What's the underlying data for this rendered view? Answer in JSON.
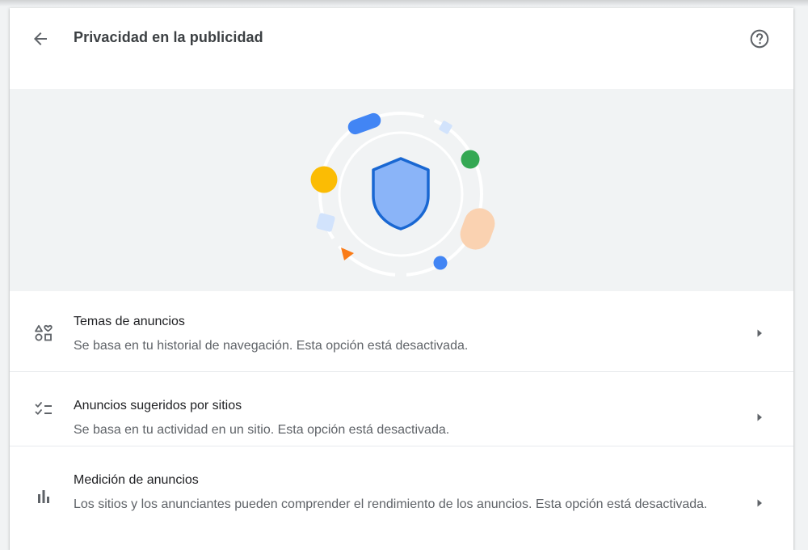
{
  "header": {
    "title": "Privacidad en la publicidad",
    "back_icon": "arrow-back-icon",
    "help_icon": "help-circle-icon"
  },
  "illustration": {
    "icon": "shield-icon",
    "colors": {
      "background": "#f1f3f4",
      "shield_fill": "#8ab4f8",
      "shield_stroke": "#1967d2",
      "blue": "#4285f4",
      "green": "#34a853",
      "yellow": "#fbbc04",
      "orange": "#fa7b17",
      "peach": "#fad2b1",
      "light_blue": "#d2e3fc"
    }
  },
  "settings": [
    {
      "icon": "topics-icon",
      "label": "Temas de anuncios",
      "description": "Se basa en tu historial de navegación. Esta opción está desactivada."
    },
    {
      "icon": "checklist-icon",
      "label": "Anuncios sugeridos por sitios",
      "description": "Se basa en tu actividad en un sitio. Esta opción está desactivada."
    },
    {
      "icon": "bar-chart-icon",
      "label": "Medición de anuncios",
      "description": "Los sitios y los anunciantes pueden comprender el rendimiento de los anuncios. Esta opción está desactivada."
    }
  ],
  "arrow_icon": "arrow-right-icon"
}
